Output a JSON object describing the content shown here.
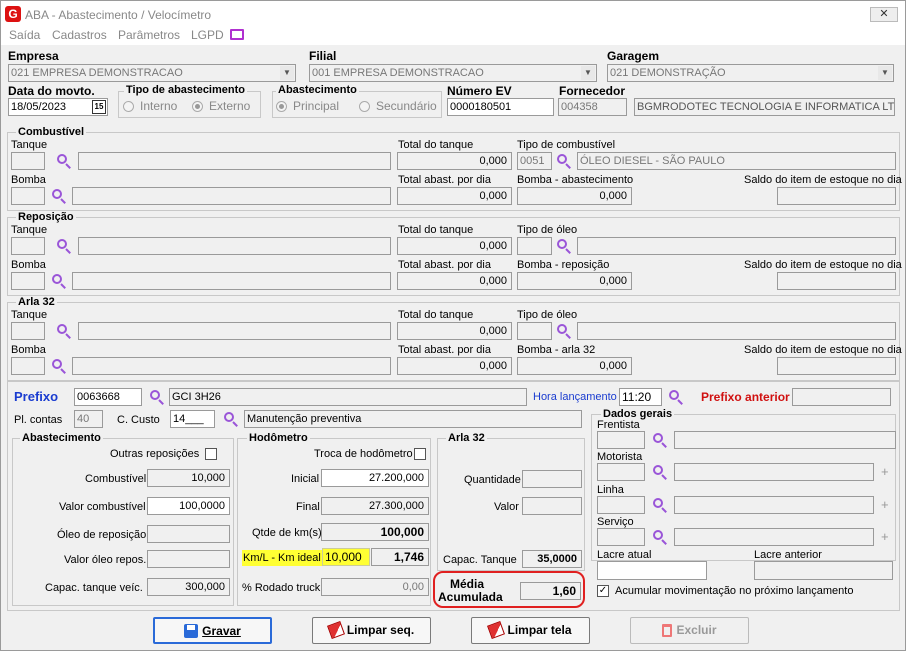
{
  "window": {
    "title": "ABA - Abastecimento / Velocímetro",
    "close": "✕",
    "logo": "G"
  },
  "menu": [
    "Saída",
    "Cadastros",
    "Parâmetros",
    "LGPD"
  ],
  "header": {
    "empresa_label": "Empresa",
    "empresa_value": "021 EMPRESA DEMONSTRACAO",
    "filial_label": "Filial",
    "filial_value": "001 EMPRESA DEMONSTRACAO",
    "garagem_label": "Garagem",
    "garagem_value": "021 DEMONSTRAÇÃO",
    "data_label": "Data do movto.",
    "data_value": "18/05/2023",
    "cal": "15",
    "tipo_label": "Tipo de abastecimento",
    "tipo_interno": "Interno",
    "tipo_externo": "Externo",
    "abast_label": "Abastecimento",
    "abast_principal": "Principal",
    "abast_secundario": "Secundário",
    "numero_label": "Número EV",
    "numero_value": "0000180501",
    "fornecedor_label": "Fornecedor",
    "fornecedor_code": "004358",
    "fornecedor_name": "BGMRODOTEC TECNOLOGIA E INFORMATICA LTDA"
  },
  "combustivel": {
    "title": "Combustível",
    "tanque": "Tanque",
    "total_tanque": "Total do tanque",
    "total_tanque_val": "0,000",
    "tipo": "Tipo de combustível",
    "tipo_code": "0051",
    "tipo_name": "ÓLEO DIESEL - SÃO PAULO",
    "bomba": "Bomba",
    "total_dia": "Total abast. por dia",
    "total_dia_val": "0,000",
    "bomba_ab": "Bomba - abastecimento",
    "bomba_ab_val": "0,000",
    "saldo": "Saldo do item de estoque no dia"
  },
  "reposicao": {
    "title": "Reposição",
    "tanque": "Tanque",
    "total_tanque": "Total do tanque",
    "total_tanque_val": "0,000",
    "tipo": "Tipo de óleo",
    "bomba": "Bomba",
    "total_dia": "Total abast. por dia",
    "total_dia_val": "0,000",
    "bomba_ab": "Bomba - reposição",
    "bomba_ab_val": "0,000",
    "saldo": "Saldo do item de estoque no dia"
  },
  "arla": {
    "title": "Arla 32",
    "tanque": "Tanque",
    "total_tanque": "Total do tanque",
    "total_tanque_val": "0,000",
    "tipo": "Tipo de óleo",
    "bomba": "Bomba",
    "total_dia": "Total abast. por dia",
    "total_dia_val": "0,000",
    "bomba_ab": "Bomba - arla 32",
    "bomba_ab_val": "0,000",
    "saldo": "Saldo do item de estoque no dia"
  },
  "prefixo": {
    "label": "Prefixo",
    "value": "0063668",
    "name": "GCI 3H26",
    "hora_label": "Hora lançamento",
    "hora_value": "11:20",
    "anterior_label": "Prefixo anterior",
    "plcontas_label": "Pl. contas",
    "plcontas_value": "40",
    "ccusto_label": "C. Custo",
    "ccusto_value": "14___",
    "ccusto_name": "Manutenção preventiva"
  },
  "abastecimento": {
    "title": "Abastecimento",
    "outras": "Outras reposições",
    "combustivel": "Combustível",
    "combustivel_val": "10,000",
    "valor_comb": "Valor combustível",
    "valor_comb_val": "100,0000",
    "oleo": "Óleo de reposição",
    "valor_oleo": "Valor óleo repos.",
    "capac": "Capac. tanque veíc.",
    "capac_val": "300,000"
  },
  "hodometro": {
    "title": "Hodômetro",
    "troca": "Troca de hodômetro",
    "inicial": "Inicial",
    "inicial_val": "27.200,000",
    "final": "Final",
    "final_val": "27.300,000",
    "qtde": "Qtde de km(s)",
    "qtde_val": "100,000",
    "kml": "Km/L - Km ideal",
    "kml_ideal": "10,000",
    "kml_val": "1,746",
    "rodado": "% Rodado truck",
    "rodado_val": "0,00"
  },
  "arla_box": {
    "title": "Arla 32",
    "quantidade": "Quantidade",
    "valor": "Valor",
    "capac": "Capac. Tanque",
    "capac_val": "35,0000",
    "media1": "Média",
    "media2": "Acumulada",
    "media_val": "1,60"
  },
  "dados": {
    "title": "Dados gerais",
    "frentista": "Frentista",
    "motorista": "Motorista",
    "linha": "Linha",
    "servico": "Serviço",
    "lacre_atual": "Lacre atual",
    "lacre_anterior": "Lacre anterior",
    "acumular": "Acumular movimentação no próximo lançamento"
  },
  "buttons": {
    "gravar": "Gravar",
    "limpar_seq": "Limpar seq.",
    "limpar_tela": "Limpar tela",
    "excluir": "Excluir"
  }
}
